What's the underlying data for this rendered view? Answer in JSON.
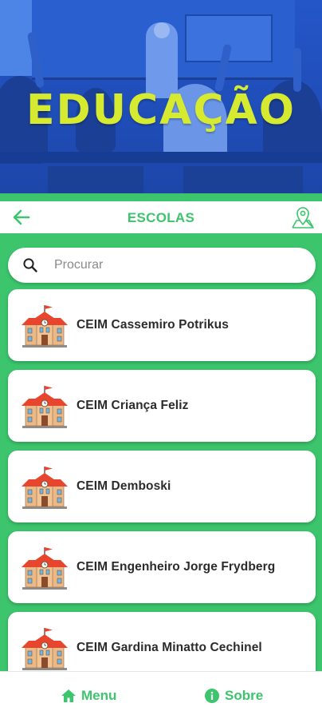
{
  "banner": {
    "title": "EDUCAÇÃO"
  },
  "header": {
    "title": "ESCOLAS",
    "back_icon": "arrow-left-icon",
    "map_icon": "map-pin-icon"
  },
  "search": {
    "placeholder": "Procurar",
    "value": "",
    "icon": "search-icon"
  },
  "schools": [
    {
      "name": "CEIM Cassemiro Potrikus"
    },
    {
      "name": "CEIM Criança Feliz"
    },
    {
      "name": "CEIM Demboski"
    },
    {
      "name": "CEIM Engenheiro Jorge Frydberg"
    },
    {
      "name": "CEIM Gardina Minatto Cechinel"
    }
  ],
  "nav": {
    "menu_label": "Menu",
    "sobre_label": "Sobre"
  },
  "colors": {
    "accent": "#3cc56c",
    "banner_title": "#d6ea2f",
    "banner_bg": "#2556c8"
  }
}
